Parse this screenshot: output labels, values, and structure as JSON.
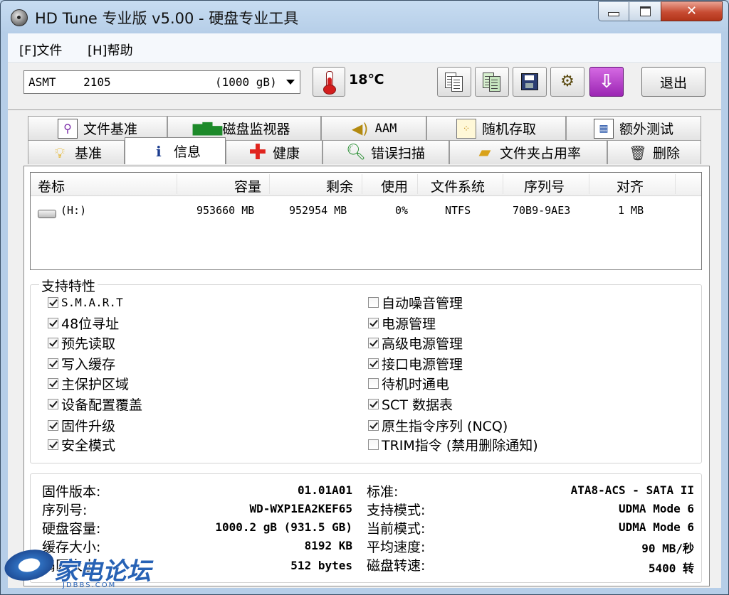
{
  "window": {
    "title": "HD Tune 专业版 v5.00 - 硬盘专业工具"
  },
  "menu": {
    "items": [
      "[F]文件",
      "[H]帮助"
    ]
  },
  "toolbar": {
    "drive_name": "ASMT    2105",
    "drive_size": "(1000 gB)",
    "temperature": "18℃",
    "exit_label": "退出",
    "buttons": [
      "copy-text-icon",
      "copy-screenshot-icon",
      "save-icon",
      "options-icon",
      "download-icon"
    ]
  },
  "tabs": {
    "row1": [
      {
        "label": "文件基准",
        "icon": "file-benchmark-icon"
      },
      {
        "label": "磁盘监视器",
        "icon": "disk-monitor-icon"
      },
      {
        "label": "AAM",
        "icon": "speaker-icon"
      },
      {
        "label": "随机存取",
        "icon": "random-access-icon"
      },
      {
        "label": "额外测试",
        "icon": "extra-tests-icon"
      }
    ],
    "row2": [
      {
        "label": "基准",
        "icon": "lightbulb-icon"
      },
      {
        "label": "信息",
        "icon": "info-icon",
        "active": true
      },
      {
        "label": "健康",
        "icon": "health-cross-icon"
      },
      {
        "label": "错误扫描",
        "icon": "magnifier-icon"
      },
      {
        "label": "文件夹占用率",
        "icon": "folder-icon"
      },
      {
        "label": "删除",
        "icon": "trash-icon"
      }
    ]
  },
  "volumes": {
    "columns": [
      "卷标",
      "容量",
      "剩余",
      "使用",
      "文件系统",
      "序列号",
      "对齐"
    ],
    "rows": [
      {
        "label": "(H:)",
        "capacity": "953660 MB",
        "free": "952954 MB",
        "used": "0%",
        "fs": "NTFS",
        "serial": "70B9-9AE3",
        "align": "1 MB"
      }
    ]
  },
  "features": {
    "title": "支持特性",
    "left": [
      {
        "label": "S.M.A.R.T",
        "checked": true
      },
      {
        "label": "48位寻址",
        "checked": true
      },
      {
        "label": "预先读取",
        "checked": true
      },
      {
        "label": "写入缓存",
        "checked": true
      },
      {
        "label": "主保护区域",
        "checked": true
      },
      {
        "label": "设备配置覆盖",
        "checked": true
      },
      {
        "label": "固件升级",
        "checked": true
      },
      {
        "label": "安全模式",
        "checked": true
      }
    ],
    "right": [
      {
        "label": "自动噪音管理",
        "checked": false
      },
      {
        "label": "电源管理",
        "checked": true
      },
      {
        "label": "高级电源管理",
        "checked": true
      },
      {
        "label": "接口电源管理",
        "checked": true
      },
      {
        "label": "待机时通电",
        "checked": false
      },
      {
        "label": "SCT 数据表",
        "checked": true
      },
      {
        "label": "原生指令序列 (NCQ)",
        "checked": true
      },
      {
        "label": "TRIM指令 (禁用删除通知)",
        "checked": false
      }
    ]
  },
  "info": {
    "left": [
      {
        "label": "固件版本:",
        "value": "01.01A01"
      },
      {
        "label": "序列号:",
        "value": "WD-WXP1EA2KEF65"
      },
      {
        "label": "硬盘容量:",
        "value": "1000.2 gB (931.5 GB)"
      },
      {
        "label": "缓存大小:",
        "value": "8192 KB"
      },
      {
        "label": "扇区大小:",
        "value": "512 bytes"
      }
    ],
    "right": [
      {
        "label": "标准:",
        "value": "ATA8-ACS - SATA II"
      },
      {
        "label": "支持模式:",
        "value": "UDMA Mode 6"
      },
      {
        "label": "当前模式:",
        "value": "UDMA Mode 6"
      },
      {
        "label": "平均速度:",
        "value": "90 MB/秒"
      },
      {
        "label": "磁盘转速:",
        "value": "5400 转"
      }
    ]
  },
  "watermark": {
    "text": "家电论坛",
    "sub": "JDBBS.COM"
  }
}
